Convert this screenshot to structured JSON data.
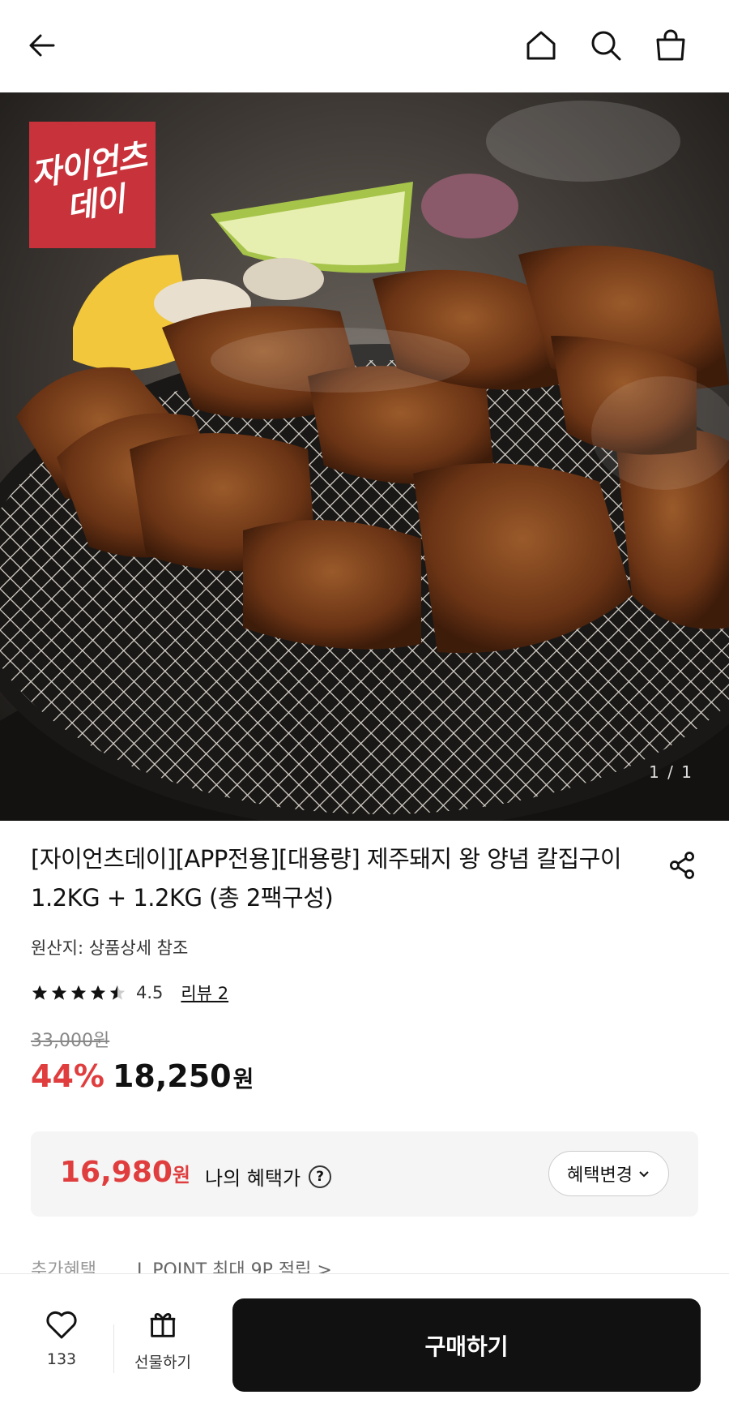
{
  "header": {
    "back_icon": "back-arrow-icon",
    "home_icon": "home-icon",
    "search_icon": "search-icon",
    "cart_icon": "shopping-bag-icon"
  },
  "hero": {
    "brand_badge_line1": "자이언츠",
    "brand_badge_line2": "데이",
    "pager": "1 / 1"
  },
  "product": {
    "title": "[자이언츠데이][APP전용][대용량] 제주돼지 왕 양념 칼집구이 1.2KG + 1.2KG (총 2팩구성)",
    "origin": "원산지: 상품상세 참조",
    "rating": "4.5",
    "rating_value": 4.5,
    "review_link": "리뷰 2",
    "original_price": "33,000원",
    "discount": "44%",
    "price": "18,250",
    "price_unit": "원"
  },
  "benefit": {
    "price": "16,980",
    "price_unit": "원",
    "label": "나의 혜택가",
    "help": "?",
    "change_button": "혜택변경"
  },
  "extra": {
    "label": "추가혜택",
    "l_point": "L.POINT 최대 9P 적립 >"
  },
  "bottom_bar": {
    "like_count": "133",
    "gift_label": "선물하기",
    "buy_label": "구매하기"
  },
  "colors": {
    "accent_red": "#e03e3e",
    "brand_red": "#c8323b",
    "buy_button": "#111111"
  }
}
